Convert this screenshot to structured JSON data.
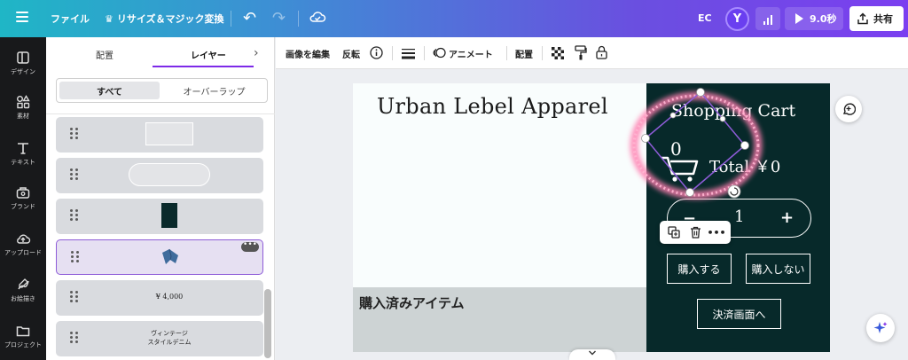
{
  "topbar": {
    "file_label": "ファイル",
    "resize_label": "リサイズ＆マジック変換",
    "ec_label": "EC",
    "avatar_initial": "Y",
    "play_duration": "9.0秒",
    "share_label": "共有",
    "icons": [
      "menu-icon",
      "crown-icon",
      "undo-icon",
      "redo-icon",
      "cloud-sync-icon",
      "bar-chart-icon",
      "play-icon",
      "share-icon"
    ]
  },
  "rail": {
    "items": [
      {
        "label": "デザイン",
        "icon": "design-icon"
      },
      {
        "label": "素材",
        "icon": "elements-icon"
      },
      {
        "label": "テキスト",
        "icon": "text-icon"
      },
      {
        "label": "ブランド",
        "icon": "brand-icon"
      },
      {
        "label": "アップロード",
        "icon": "upload-icon"
      },
      {
        "label": "お絵描き",
        "icon": "draw-icon"
      },
      {
        "label": "プロジェクト",
        "icon": "folder-icon"
      }
    ]
  },
  "panel": {
    "tab_arrange": "配置",
    "tab_layers": "レイヤー",
    "filter_all": "すべて",
    "filter_overlap": "オーバーラップ",
    "layers": [
      {
        "type": "rect"
      },
      {
        "type": "pill"
      },
      {
        "type": "dark"
      },
      {
        "type": "jeans",
        "selected": true,
        "more": "•••"
      },
      {
        "type": "text",
        "text": "¥ 4,000"
      },
      {
        "type": "text",
        "text": "ヴィンテージ\nスタイルデニム"
      }
    ]
  },
  "context_toolbar": {
    "edit_image": "画像を編集",
    "flip": "反転",
    "animate": "アニメート",
    "arrange": "配置",
    "icons": [
      "info-icon",
      "line-weight-icon",
      "animate-icon",
      "transparency-icon",
      "paint-roller-icon",
      "lock-icon"
    ]
  },
  "canvas": {
    "title": "Urban Lebel Apparel",
    "purchased_label": "購入済みアイテム",
    "cart_title": "Shopping Cart",
    "cart_count": "0",
    "cart_total": "Total ￥0",
    "qty_minus": "−",
    "qty_value": "1",
    "qty_plus": "+",
    "buy_label": "購入する",
    "nobuy_label": "購入しない",
    "checkout_label": "決済画面へ",
    "colors": {
      "cart_bg": "#07292a",
      "accent": "#7d2ae8",
      "glow": "#ff7fb0"
    }
  },
  "floating_toolbar": {
    "more": "•••",
    "icons": [
      "duplicate-icon",
      "trash-icon",
      "more-icon"
    ]
  }
}
